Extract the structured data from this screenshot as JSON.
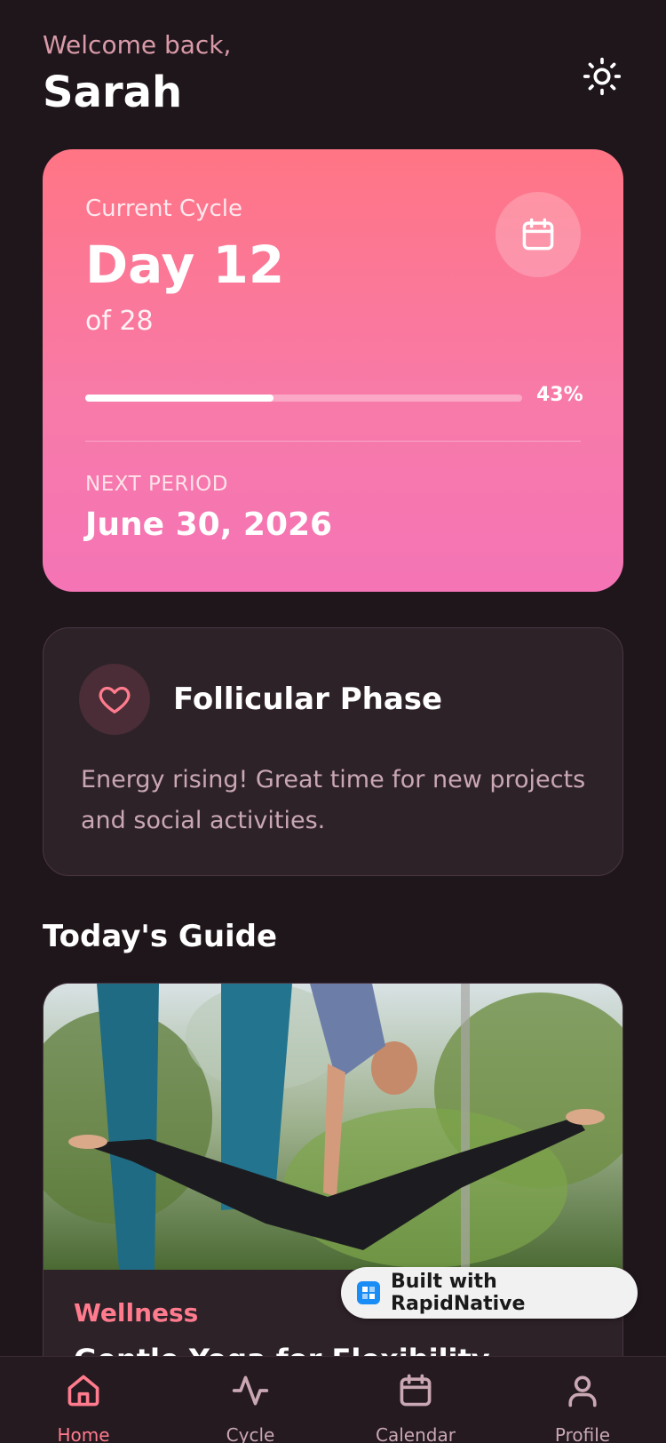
{
  "header": {
    "greeting": "Welcome back,",
    "username": "Sarah",
    "theme_icon": "sun-icon"
  },
  "cycle_card": {
    "label": "Current Cycle",
    "day": "Day 12",
    "of_total": "of 28",
    "progress_percent": 43,
    "progress_label": "43%",
    "calendar_icon": "calendar-icon",
    "next_period_label": "NEXT PERIOD",
    "next_period_date": "June 30, 2026",
    "gradient_top": "#ff7585",
    "gradient_bottom": "#f474b5"
  },
  "phase_card": {
    "icon": "heart-icon",
    "title": "Follicular Phase",
    "description": "Energy rising! Great time for new projects and social activities."
  },
  "guide": {
    "section_title": "Today's Guide",
    "card": {
      "category": "Wellness",
      "headline": "Gentle Yoga for Flexibility"
    }
  },
  "badge": {
    "text": "Built with RapidNative"
  },
  "tabbar": {
    "tabs": [
      {
        "label": "Home",
        "icon": "home-icon",
        "active": true
      },
      {
        "label": "Cycle",
        "icon": "activity-icon",
        "active": false
      },
      {
        "label": "Calendar",
        "icon": "calendar-icon",
        "active": false
      },
      {
        "label": "Profile",
        "icon": "user-icon",
        "active": false
      }
    ]
  },
  "colors": {
    "background": "#1f161c",
    "accent": "#ff7b8d",
    "muted_text": "#c9a7b3",
    "card": "#2e2229"
  }
}
